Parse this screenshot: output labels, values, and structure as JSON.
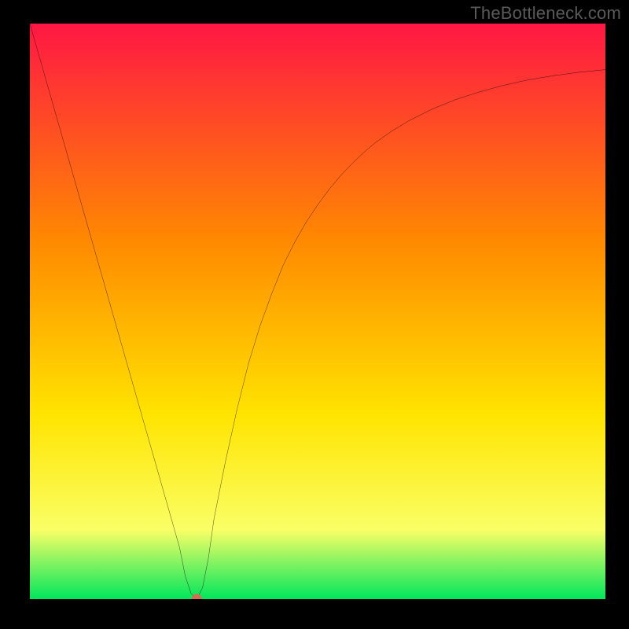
{
  "watermark": "TheBottleneck.com",
  "chart_data": {
    "type": "line",
    "title": "",
    "xlabel": "",
    "ylabel": "",
    "xlim": [
      0,
      100
    ],
    "ylim": [
      0,
      100
    ],
    "grid": false,
    "gradient_colors": {
      "top": "#ff1744",
      "mid_upper": "#ff8a00",
      "mid": "#ffe400",
      "lower": "#faff66",
      "bottom": "#00e65c"
    },
    "curve": {
      "x": [
        0,
        2,
        4,
        6,
        8,
        10,
        12,
        14,
        16,
        18,
        20,
        22,
        24,
        26,
        27,
        28,
        29,
        30,
        31,
        32,
        34,
        36,
        38,
        40,
        42,
        44,
        46,
        48,
        50,
        52,
        54,
        56,
        58,
        60,
        63,
        66,
        70,
        74,
        78,
        82,
        86,
        90,
        95,
        100
      ],
      "y": [
        100,
        93,
        86,
        79,
        72,
        65,
        58,
        51,
        44,
        37,
        30,
        23,
        16,
        9,
        4,
        1,
        0,
        2,
        7,
        14,
        24,
        33,
        41,
        47.5,
        53,
        58,
        62,
        65.5,
        68.5,
        71.2,
        73.6,
        75.7,
        77.6,
        79.3,
        81.4,
        83.2,
        85.2,
        86.8,
        88.1,
        89.2,
        90.1,
        90.8,
        91.5,
        92
      ]
    },
    "marker": {
      "x": 29,
      "y": 0,
      "color": "#d96b54",
      "r": 6
    }
  }
}
